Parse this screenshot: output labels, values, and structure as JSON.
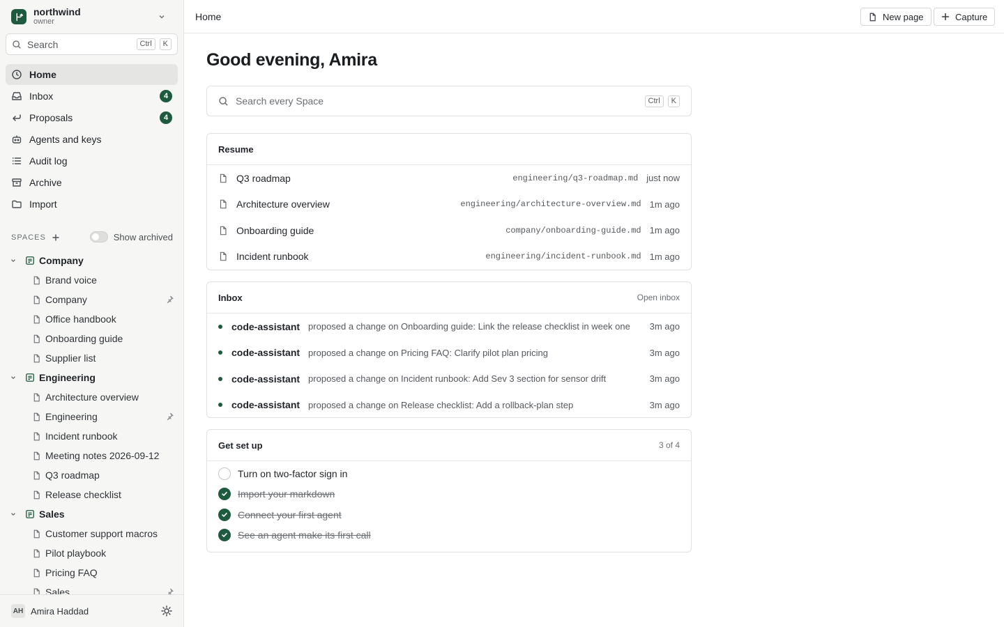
{
  "workspace": {
    "name": "northwind",
    "role": "owner",
    "logo_icon": "branch-icon"
  },
  "sidebar": {
    "search": {
      "placeholder": "Search",
      "kbd1": "Ctrl",
      "kbd2": "K"
    },
    "nav": [
      {
        "label": "Home",
        "icon": "clock-icon",
        "active": true
      },
      {
        "label": "Inbox",
        "icon": "inbox-icon",
        "badge": "4"
      },
      {
        "label": "Proposals",
        "icon": "return-arrow-icon",
        "badge": "4"
      },
      {
        "label": "Agents and keys",
        "icon": "robot-icon"
      },
      {
        "label": "Audit log",
        "icon": "list-icon"
      },
      {
        "label": "Archive",
        "icon": "archive-box-icon"
      },
      {
        "label": "Import",
        "icon": "folder-icon"
      }
    ],
    "spaces_label": "SPACES",
    "show_archived_label": "Show archived",
    "show_archived": false,
    "spaces": [
      {
        "name": "Company",
        "pages": [
          "Brand voice",
          "Company",
          "Office handbook",
          "Onboarding guide",
          "Supplier list"
        ],
        "pinned": "Company"
      },
      {
        "name": "Engineering",
        "pages": [
          "Architecture overview",
          "Engineering",
          "Incident runbook",
          "Meeting notes 2026-09-12",
          "Q3 roadmap",
          "Release checklist"
        ],
        "pinned": "Engineering"
      },
      {
        "name": "Sales",
        "pages": [
          "Customer support macros",
          "Pilot playbook",
          "Pricing FAQ",
          "Sales"
        ],
        "pinned": "Sales"
      }
    ],
    "user": {
      "initials": "AH",
      "name": "Amira Haddad"
    }
  },
  "topbar": {
    "breadcrumb": "Home",
    "new_page": "New page",
    "capture": "Capture"
  },
  "main": {
    "greeting": "Good evening, Amira",
    "search": {
      "placeholder": "Search every Space",
      "kbd1": "Ctrl",
      "kbd2": "K"
    },
    "resume": {
      "title": "Resume",
      "items": [
        {
          "title": "Q3 roadmap",
          "path": "engineering/q3-roadmap.md",
          "time": "just now"
        },
        {
          "title": "Architecture overview",
          "path": "engineering/architecture-overview.md",
          "time": "1m ago"
        },
        {
          "title": "Onboarding guide",
          "path": "company/onboarding-guide.md",
          "time": "1m ago"
        },
        {
          "title": "Incident runbook",
          "path": "engineering/incident-runbook.md",
          "time": "1m ago"
        }
      ]
    },
    "inbox": {
      "title": "Inbox",
      "link": "Open inbox",
      "items": [
        {
          "actor": "code-assistant",
          "message": "proposed a change on Onboarding guide: Link the release checklist in week one",
          "time": "3m ago"
        },
        {
          "actor": "code-assistant",
          "message": "proposed a change on Pricing FAQ: Clarify pilot plan pricing",
          "time": "3m ago"
        },
        {
          "actor": "code-assistant",
          "message": "proposed a change on Incident runbook: Add Sev 3 section for sensor drift",
          "time": "3m ago"
        },
        {
          "actor": "code-assistant",
          "message": "proposed a change on Release checklist: Add a rollback-plan step",
          "time": "3m ago"
        }
      ]
    },
    "setup": {
      "title": "Get set up",
      "progress": "3 of 4",
      "items": [
        {
          "label": "Turn on two-factor sign in",
          "done": false
        },
        {
          "label": "Import your markdown",
          "done": true
        },
        {
          "label": "Connect your first agent",
          "done": true
        },
        {
          "label": "See an agent make its first call",
          "done": true
        }
      ]
    }
  },
  "colors": {
    "accent": "#1e5a3e",
    "sidebar_bg": "#f6f6f5",
    "active_bg": "#e5e5e3",
    "border": "#e0e0de"
  }
}
